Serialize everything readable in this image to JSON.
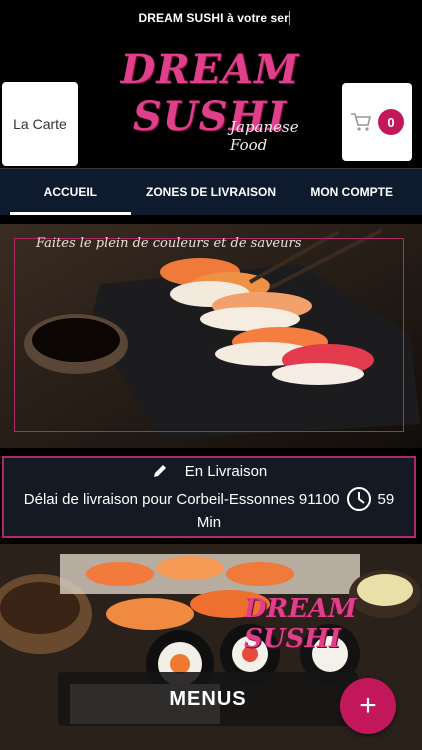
{
  "topbar": {
    "ticker": "DREAM SUSHI à votre servi"
  },
  "header": {
    "carte_label": "La Carte",
    "logo_main": "DREAM SUSHI",
    "logo_sub": "Japanese Food",
    "cart_count": "0"
  },
  "nav": {
    "items": [
      {
        "label": "ACCUEIL"
      },
      {
        "label": "ZONES DE LIVRAISON"
      },
      {
        "label": "MON COMPTE"
      }
    ]
  },
  "hero": {
    "caption": "Faites le plein de couleurs et de saveurs"
  },
  "delivery": {
    "mode": "En Livraison",
    "text": "Délai de livraison pour Corbeil-Essonnes 91100",
    "minutes": "59",
    "unit": "Min"
  },
  "menus": {
    "logo_text": "DREAM SUSHI",
    "button_label": "MENUS"
  },
  "fab": {
    "symbol": "+"
  },
  "colors": {
    "accent": "#c2185b",
    "nav_bg": "#0e1b2e"
  }
}
